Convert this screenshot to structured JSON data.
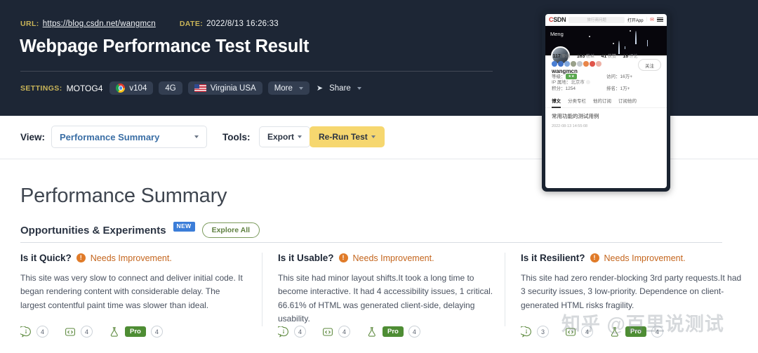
{
  "header": {
    "url_label": "URL:",
    "url": "https://blog.csdn.net/wangmcn",
    "date_label": "DATE:",
    "date": "2022/8/13 16:26:33",
    "title": "Webpage Performance Test Result",
    "settings_label": "SETTINGS:",
    "device": "MOTOG4",
    "browser": "v104",
    "connection": "4G",
    "location": "Virginia USA",
    "more": "More",
    "share": "Share"
  },
  "toolbar": {
    "view_label": "View:",
    "view_value": "Performance Summary",
    "tools_label": "Tools:",
    "export_label": "Export",
    "rerun_label": "Re-Run Test"
  },
  "main": {
    "heading": "Performance Summary",
    "section_title": "Opportunities & Experiments",
    "new_badge": "NEW",
    "explore_all": "Explore All",
    "columns": [
      {
        "question": "Is it Quick?",
        "status": "Needs Improvement.",
        "body": "This site was very slow to connect and deliver initial code. It began rendering content with considerable delay. The largest contentful paint time was slower than ideal.",
        "metrics": [
          {
            "icon": "info-bubble-icon",
            "count": "4"
          },
          {
            "icon": "code-window-icon",
            "count": "4"
          },
          {
            "icon": "experiment-flask-icon",
            "badge": "Pro",
            "count": "4"
          }
        ]
      },
      {
        "question": "Is it Usable?",
        "status": "Needs Improvement.",
        "body": "This site had minor layout shifts.It took a long time to become interactive. It had 4 accessibility issues, 1 critical. 66.61% of HTML was generated client-side, delaying usability.",
        "metrics": [
          {
            "icon": "info-bubble-icon",
            "count": "4"
          },
          {
            "icon": "code-window-icon",
            "count": "4"
          },
          {
            "icon": "experiment-flask-icon",
            "badge": "Pro",
            "count": "4"
          }
        ]
      },
      {
        "question": "Is it Resilient?",
        "status": "Needs Improvement.",
        "body": "This site had zero render-blocking 3rd party requests.It had 3 security issues, 3 low-priority. Dependence on client-generated HTML risks fragility.",
        "metrics": [
          {
            "icon": "info-bubble-icon",
            "count": "3"
          },
          {
            "icon": "code-window-icon",
            "count": "4"
          },
          {
            "icon": "experiment-flask-icon",
            "badge": "Pro",
            "count": "4"
          }
        ]
      }
    ]
  },
  "preview": {
    "logo": "CSDN",
    "logo_accent": "C",
    "search_placeholder": "旅行商问题",
    "open_app": "打开App",
    "divider": "|",
    "hero_name": "Meng",
    "username": "wangmcn",
    "follow": "关注",
    "ip_location": "IP 属地：北京市",
    "stats": [
      {
        "value": "117",
        "label": "原创"
      },
      {
        "value": "163",
        "label": "粉丝"
      },
      {
        "value": "41",
        "label": "获赞"
      },
      {
        "value": "18",
        "label": "评论"
      }
    ],
    "level_label": "等级：",
    "visits": "访问：16万+",
    "points": "积分：1254",
    "rank": "排名：1万+",
    "tabs": [
      "博文",
      "分类专栏",
      "他的订阅",
      "订阅他的"
    ],
    "article_title": "常用功能的测试用例",
    "article_date": "2022-08-13 14:55:08"
  },
  "watermark": "知乎 @百里说测试",
  "colors": {
    "header_bg": "#1d2635",
    "accent_yellow": "#c9b458",
    "link_blue": "#3a6ea5",
    "rerun_bg": "#f6d76f",
    "warn_orange": "#e07b29",
    "pro_green": "#4e8d34",
    "new_blue": "#3b7dd8"
  }
}
